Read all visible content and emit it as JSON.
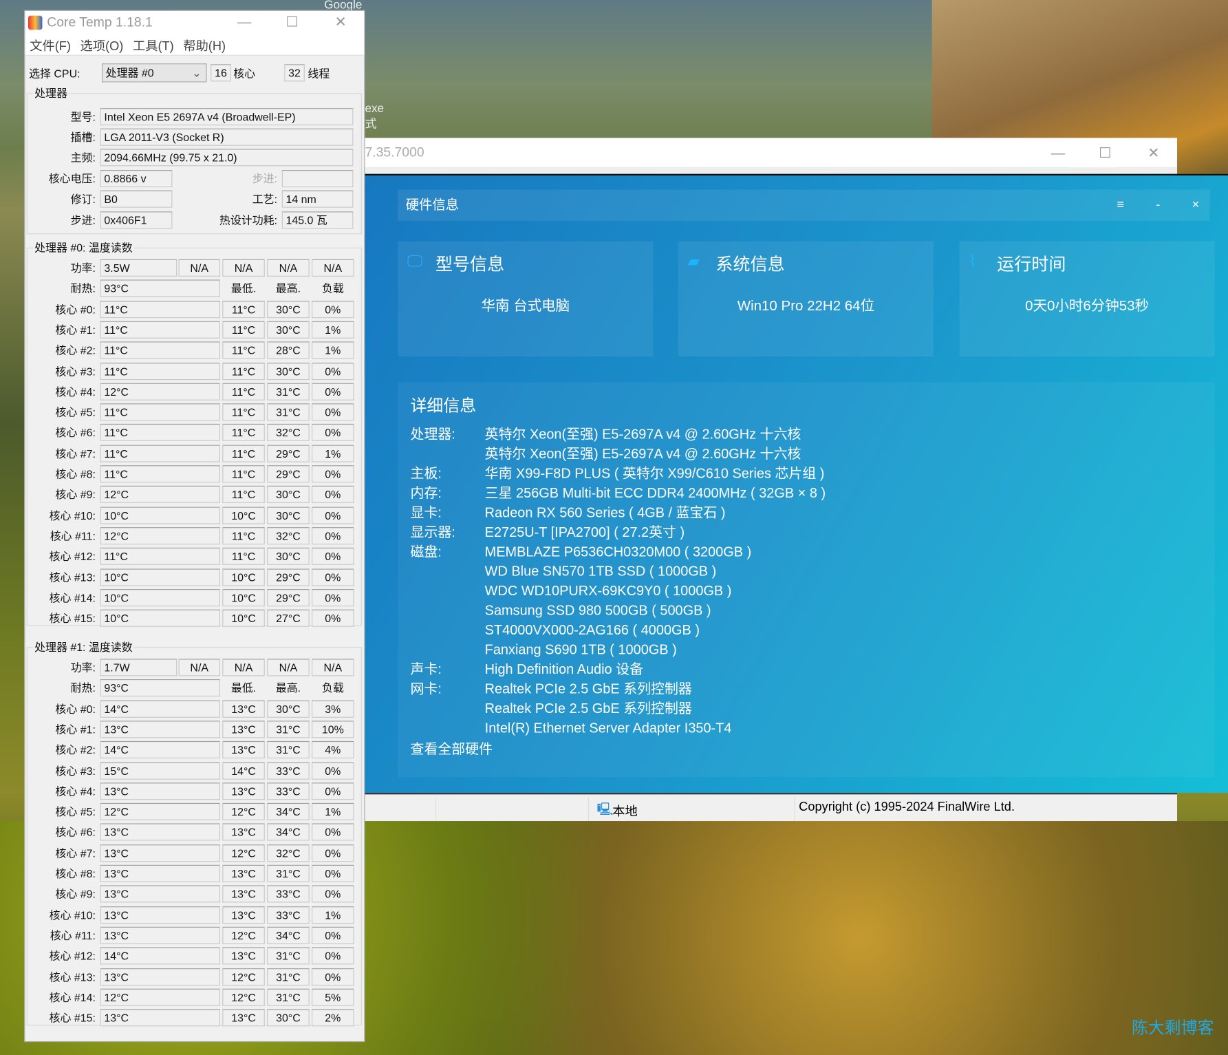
{
  "desktop": {
    "google_label": "Google",
    "exe_fragment": "exe",
    "exe_fragment2": "式",
    "watermark": "陈大剩博客"
  },
  "coretemp": {
    "title": "Core Temp 1.18.1",
    "menu": [
      "文件(F)",
      "选项(O)",
      "工具(T)",
      "帮助(H)"
    ],
    "select_cpu_label": "选择 CPU:",
    "select_cpu_value": "处理器 #0",
    "cores": "16",
    "cores_label": "核心",
    "threads": "32",
    "threads_label": "线程",
    "processor_group": "处理器",
    "info": {
      "model_label": "型号:",
      "model": "Intel Xeon E5 2697A v4 (Broadwell-EP)",
      "socket_label": "插槽:",
      "socket": "LGA 2011-V3 (Socket R)",
      "freq_label": "主频:",
      "freq": "2094.66MHz (99.75 x 21.0)",
      "vcore_label": "核心电压:",
      "vcore": "0.8866 v",
      "stepping_dim_label": "步进:",
      "stepping_dim": "",
      "revision_label": "修订:",
      "revision": "B0",
      "litho_label": "工艺:",
      "litho": "14 nm",
      "cpuid_label": "步进:",
      "cpuid": "0x406F1",
      "tdp_label": "热设计功耗:",
      "tdp": "145.0 瓦"
    },
    "labels": {
      "power": "功率:",
      "tj": "耐热:",
      "min": "最低.",
      "max": "最高.",
      "load": "负载",
      "na": "N/A"
    },
    "processors": [
      {
        "title": "处理器 #0: 温度读数",
        "power": "3.5W",
        "tjmax": "93°C",
        "cores": [
          [
            "核心 #0:",
            "11°C",
            "11°C",
            "30°C",
            "0%"
          ],
          [
            "核心 #1:",
            "11°C",
            "11°C",
            "30°C",
            "1%"
          ],
          [
            "核心 #2:",
            "11°C",
            "11°C",
            "28°C",
            "1%"
          ],
          [
            "核心 #3:",
            "11°C",
            "11°C",
            "30°C",
            "0%"
          ],
          [
            "核心 #4:",
            "12°C",
            "11°C",
            "31°C",
            "0%"
          ],
          [
            "核心 #5:",
            "11°C",
            "11°C",
            "31°C",
            "0%"
          ],
          [
            "核心 #6:",
            "11°C",
            "11°C",
            "32°C",
            "0%"
          ],
          [
            "核心 #7:",
            "11°C",
            "11°C",
            "29°C",
            "1%"
          ],
          [
            "核心 #8:",
            "11°C",
            "11°C",
            "29°C",
            "0%"
          ],
          [
            "核心 #9:",
            "12°C",
            "11°C",
            "30°C",
            "0%"
          ],
          [
            "核心 #10:",
            "10°C",
            "10°C",
            "30°C",
            "0%"
          ],
          [
            "核心 #11:",
            "12°C",
            "11°C",
            "32°C",
            "0%"
          ],
          [
            "核心 #12:",
            "11°C",
            "11°C",
            "30°C",
            "0%"
          ],
          [
            "核心 #13:",
            "10°C",
            "10°C",
            "29°C",
            "0%"
          ],
          [
            "核心 #14:",
            "10°C",
            "10°C",
            "29°C",
            "0%"
          ],
          [
            "核心 #15:",
            "10°C",
            "10°C",
            "27°C",
            "0%"
          ]
        ]
      },
      {
        "title": "处理器 #1: 温度读数",
        "power": "1.7W",
        "tjmax": "93°C",
        "cores": [
          [
            "核心 #0:",
            "14°C",
            "13°C",
            "30°C",
            "3%"
          ],
          [
            "核心 #1:",
            "13°C",
            "13°C",
            "31°C",
            "10%"
          ],
          [
            "核心 #2:",
            "14°C",
            "13°C",
            "31°C",
            "4%"
          ],
          [
            "核心 #3:",
            "15°C",
            "14°C",
            "33°C",
            "0%"
          ],
          [
            "核心 #4:",
            "13°C",
            "13°C",
            "33°C",
            "0%"
          ],
          [
            "核心 #5:",
            "12°C",
            "12°C",
            "34°C",
            "1%"
          ],
          [
            "核心 #6:",
            "13°C",
            "13°C",
            "34°C",
            "0%"
          ],
          [
            "核心 #7:",
            "13°C",
            "12°C",
            "32°C",
            "0%"
          ],
          [
            "核心 #8:",
            "13°C",
            "13°C",
            "31°C",
            "0%"
          ],
          [
            "核心 #9:",
            "13°C",
            "13°C",
            "33°C",
            "0%"
          ],
          [
            "核心 #10:",
            "13°C",
            "13°C",
            "33°C",
            "1%"
          ],
          [
            "核心 #11:",
            "13°C",
            "12°C",
            "34°C",
            "0%"
          ],
          [
            "核心 #12:",
            "14°C",
            "13°C",
            "31°C",
            "0%"
          ],
          [
            "核心 #13:",
            "13°C",
            "12°C",
            "31°C",
            "0%"
          ],
          [
            "核心 #14:",
            "12°C",
            "12°C",
            "31°C",
            "5%"
          ],
          [
            "核心 #15:",
            "13°C",
            "13°C",
            "30°C",
            "2%"
          ]
        ]
      }
    ]
  },
  "aida": {
    "title_fragment": "7.35.7000",
    "status_local": "本地",
    "status_copyright": "Copyright (c) 1995-2024 FinalWire Ltd."
  },
  "hwinfo": {
    "title": "硬件信息",
    "menu_icon": "≡",
    "minimize": "-",
    "close": "×",
    "cards": [
      {
        "icon": "monitor-icon",
        "title": "型号信息",
        "value": "华南  台式电脑"
      },
      {
        "icon": "windows-icon",
        "title": "系统信息",
        "value": "Win10 Pro 22H2 64位"
      },
      {
        "icon": "pulse-icon",
        "title": "运行时间",
        "value": "0天0小时6分钟53秒"
      }
    ],
    "detail_title": "详细信息",
    "rows": [
      {
        "k": "处理器:",
        "v": "英特尔 Xeon(至强) E5-2697A v4 @ 2.60GHz 十六核"
      },
      {
        "k": "",
        "v": "英特尔 Xeon(至强) E5-2697A v4 @ 2.60GHz 十六核"
      },
      {
        "k": "主板:",
        "v": "华南 X99-F8D PLUS ( 英特尔 X99/C610 Series 芯片组 )"
      },
      {
        "k": "内存:",
        "v": "三星 256GB Multi-bit ECC DDR4 2400MHz ( 32GB × 8 )"
      },
      {
        "k": "显卡:",
        "v": "Radeon RX 560 Series ( 4GB / 蓝宝石 )"
      },
      {
        "k": "显示器:",
        "v": "E2725U-T [IPA2700] ( 27.2英寸 )"
      },
      {
        "k": "磁盘:",
        "v": "MEMBLAZE P6536CH0320M00 ( 3200GB )"
      },
      {
        "k": "",
        "v": "WD Blue SN570 1TB SSD ( 1000GB )"
      },
      {
        "k": "",
        "v": "WDC WD10PURX-69KC9Y0 ( 1000GB )"
      },
      {
        "k": "",
        "v": "Samsung SSD 980 500GB ( 500GB )"
      },
      {
        "k": "",
        "v": "ST4000VX000-2AG166 ( 4000GB )"
      },
      {
        "k": "",
        "v": "Fanxiang S690 1TB ( 1000GB )"
      },
      {
        "k": "声卡:",
        "v": "High Definition Audio 设备"
      },
      {
        "k": "网卡:",
        "v": "Realtek PCIe 2.5 GbE 系列控制器"
      },
      {
        "k": "",
        "v": "Realtek PCIe 2.5 GbE 系列控制器"
      },
      {
        "k": "",
        "v": "Intel(R) Ethernet Server Adapter I350-T4"
      }
    ],
    "view_all": "查看全部硬件"
  }
}
